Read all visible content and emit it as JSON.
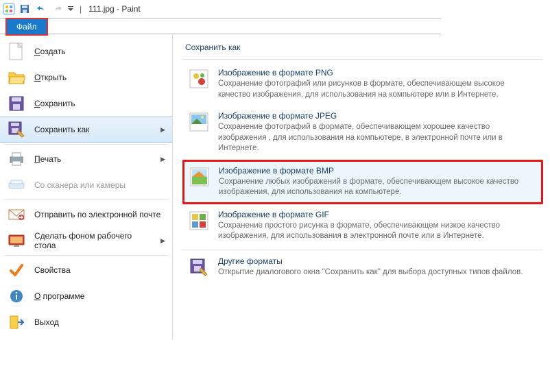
{
  "title": "111.jpg - Paint",
  "tabs": {
    "file": "Файл"
  },
  "menu": {
    "new": "Создать",
    "open": "Открыть",
    "save": "Сохранить",
    "saveAs": "Сохранить как",
    "print": "Печать",
    "scanner": "Со сканера или камеры",
    "email": "Отправить по электронной почте",
    "wallpaper": "Сделать фоном рабочего стола",
    "properties": "Свойства",
    "about": "О программе",
    "exit": "Выход"
  },
  "submenu": {
    "header": "Сохранить как",
    "formats": [
      {
        "key": "png",
        "title": "Изображение в формате PNG",
        "desc": "Сохранение фотографий или рисунков в формате, обеспечивающем высокое качество изображения, для использования на компьютере или в Интернете."
      },
      {
        "key": "jpeg",
        "title": "Изображение в формате JPEG",
        "desc": "Сохранение фотографий в формате, обеспечивающем хорошее качество изображения , для использования на компьютере, в электронной почте или в Интернете."
      },
      {
        "key": "bmp",
        "title": "Изображение в формате BMP",
        "desc": "Сохранение любых изображений в формате, обеспечивающем высокое качество изображения, для использования на компьютере."
      },
      {
        "key": "gif",
        "title": "Изображение в формате GIF",
        "desc": "Сохранение простого рисунка в формате, обеспечивающем низкое качество изображения, для использования в электронной почте или в Интернете."
      },
      {
        "key": "other",
        "title": "Другие форматы",
        "desc": "Открытие диалогового окна \"Сохранить как\" для выбора доступных типов файлов."
      }
    ]
  }
}
